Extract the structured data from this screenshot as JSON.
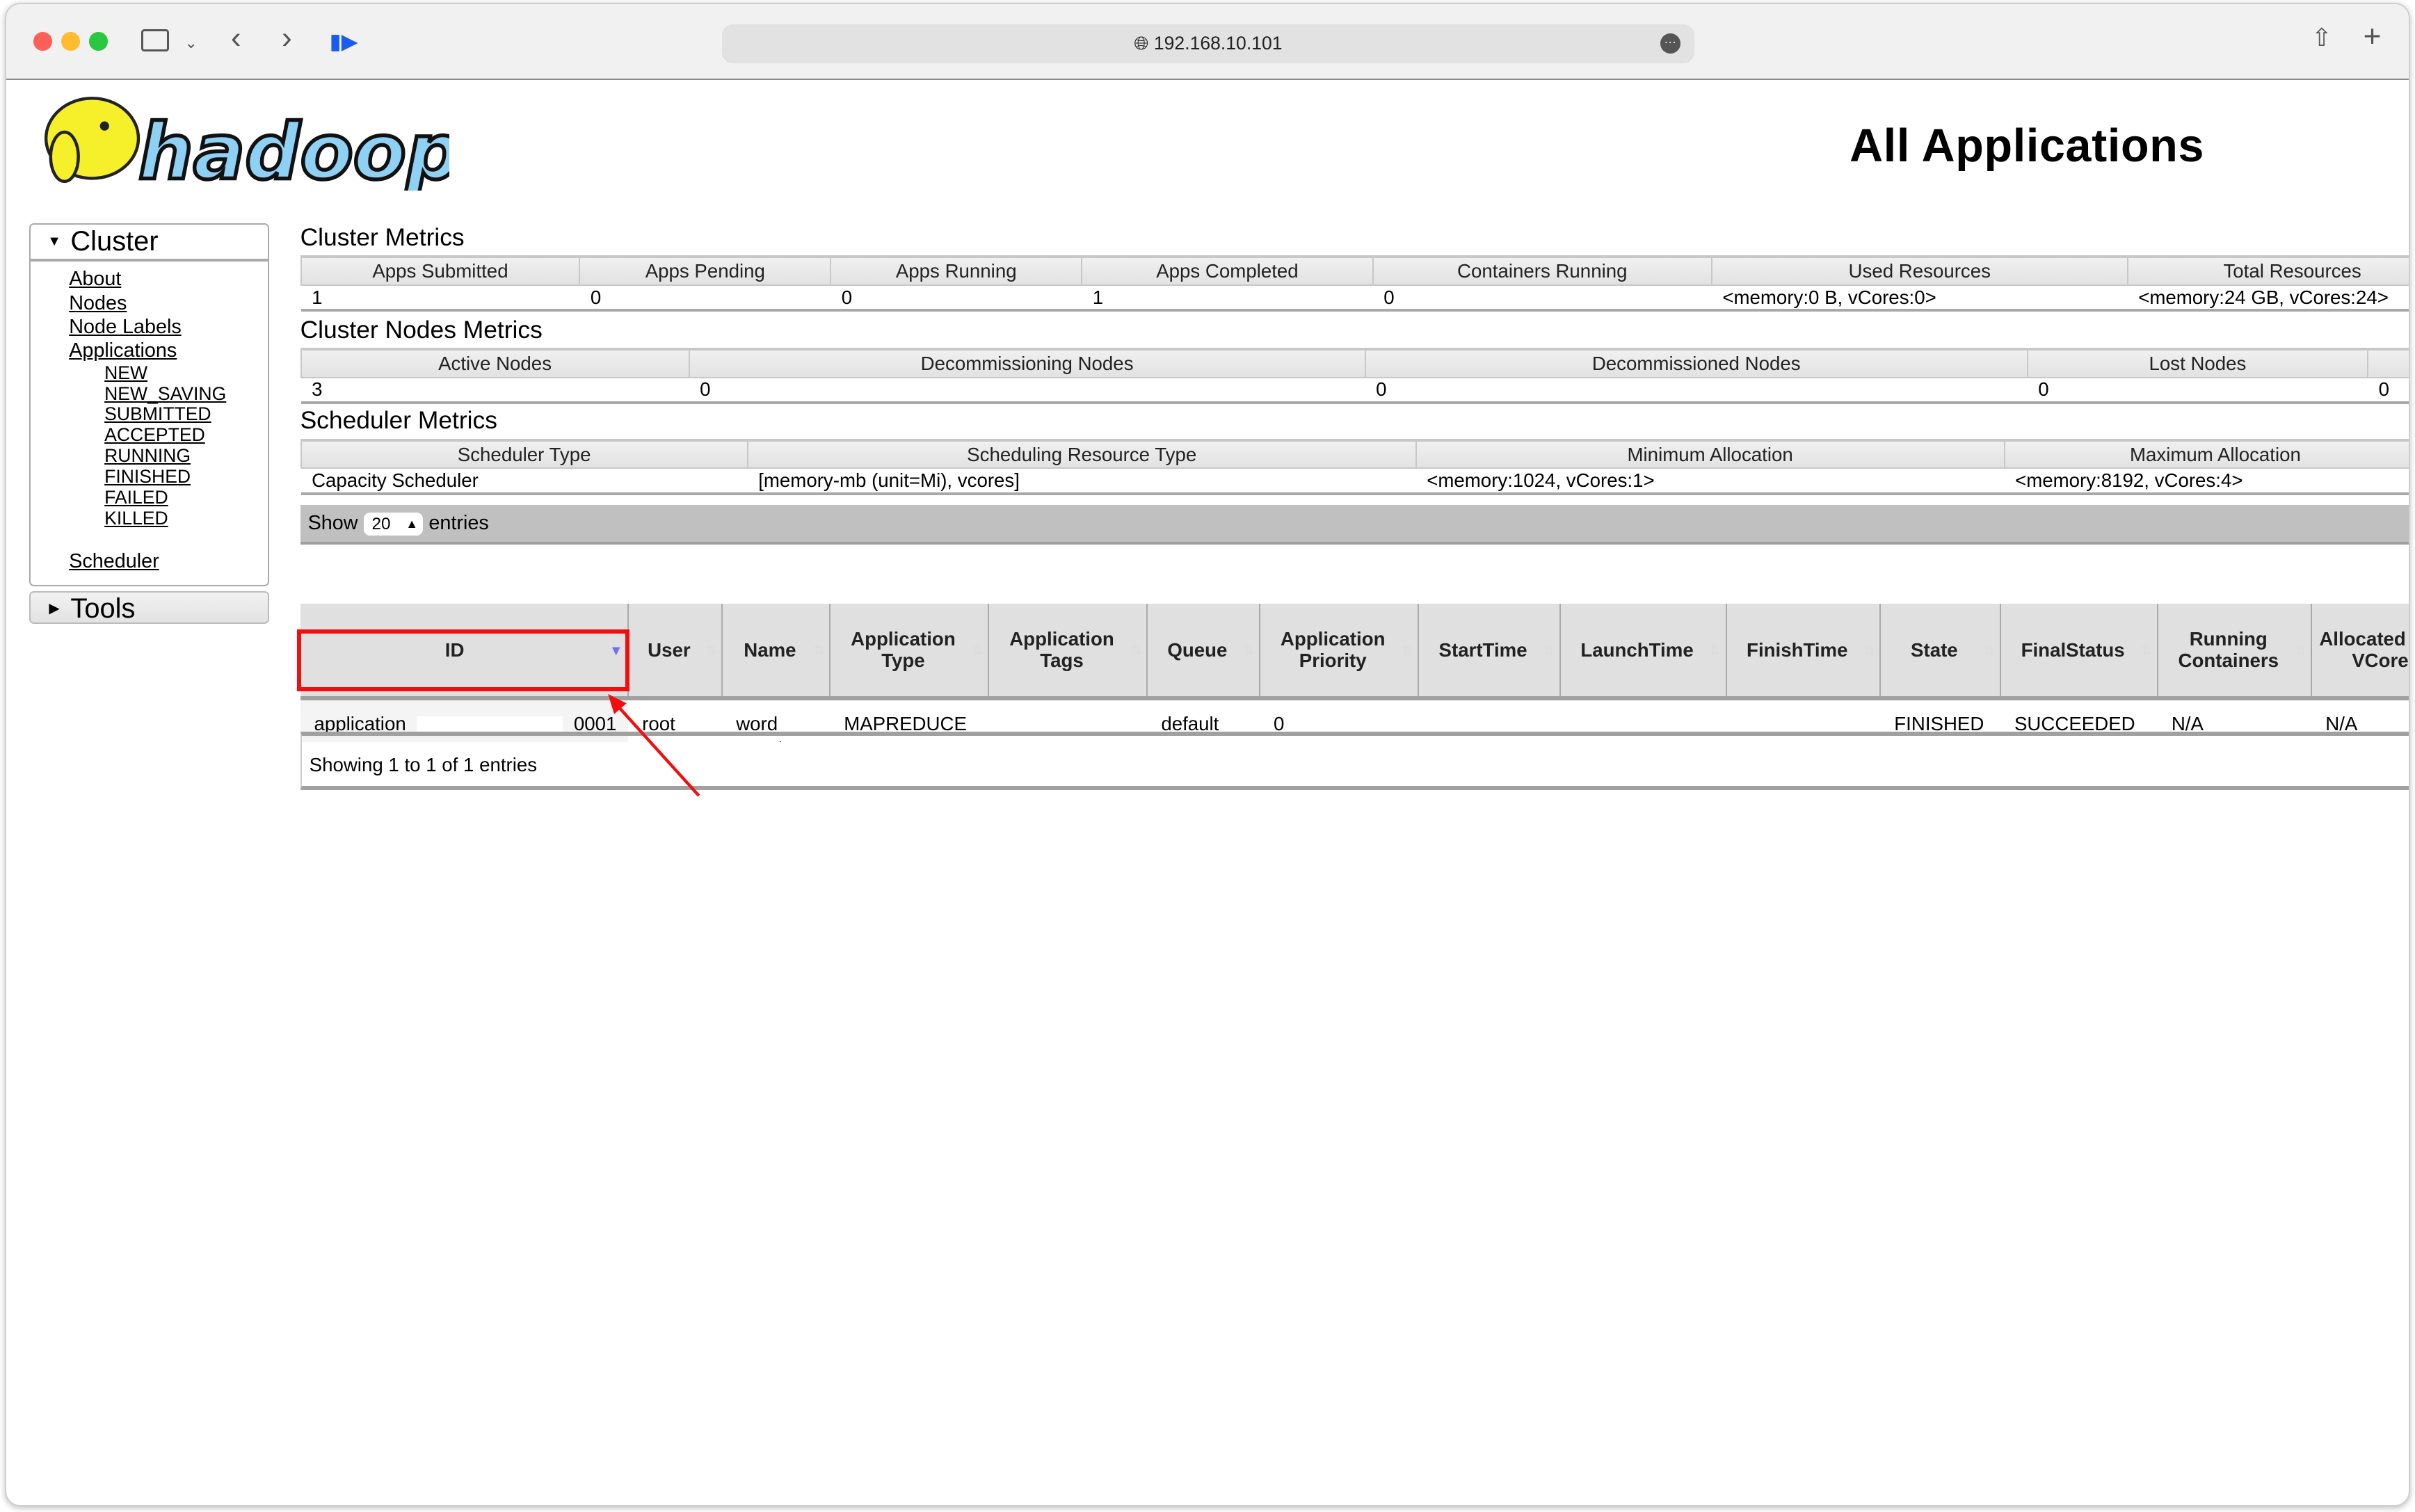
{
  "browser": {
    "url": "192.168.10.101"
  },
  "header": {
    "title": "All Applications",
    "logo_text": "hadoop"
  },
  "sidebar": {
    "cluster_label": "Cluster",
    "items": [
      {
        "label": "About",
        "level": 1
      },
      {
        "label": "Nodes",
        "level": 1
      },
      {
        "label": "Node Labels",
        "level": 1
      },
      {
        "label": "Applications",
        "level": 1
      },
      {
        "label": "NEW",
        "level": 2
      },
      {
        "label": "NEW_SAVING",
        "level": 2
      },
      {
        "label": "SUBMITTED",
        "level": 2
      },
      {
        "label": "ACCEPTED",
        "level": 2
      },
      {
        "label": "RUNNING",
        "level": 2
      },
      {
        "label": "FINISHED",
        "level": 2
      },
      {
        "label": "FAILED",
        "level": 2
      },
      {
        "label": "KILLED",
        "level": 2
      }
    ],
    "scheduler_label": "Scheduler",
    "tools_label": "Tools"
  },
  "cluster_metrics": {
    "title": "Cluster Metrics",
    "headers": [
      "Apps Submitted",
      "Apps Pending",
      "Apps Running",
      "Apps Completed",
      "Containers Running",
      "Used Resources",
      "Total Resources"
    ],
    "values": [
      "1",
      "0",
      "0",
      "1",
      "0",
      "<memory:0 B, vCores:0>",
      "<memory:24 GB, vCores:24>"
    ]
  },
  "nodes_metrics": {
    "title": "Cluster Nodes Metrics",
    "headers": [
      "Active Nodes",
      "Decommissioning Nodes",
      "Decommissioned Nodes",
      "Lost Nodes",
      ""
    ],
    "values": [
      "3",
      "0",
      "0",
      "0",
      "0"
    ]
  },
  "scheduler_metrics": {
    "title": "Scheduler Metrics",
    "headers": [
      "Scheduler Type",
      "Scheduling Resource Type",
      "Minimum Allocation",
      "Maximum Allocation"
    ],
    "values": [
      "Capacity Scheduler",
      "[memory-mb (unit=Mi), vcores]",
      "<memory:1024, vCores:1>",
      "<memory:8192, vCores:4>"
    ]
  },
  "apps_table": {
    "show_label": "Show",
    "page_size": "20",
    "entries_label": "entries",
    "headers": [
      "ID",
      "User",
      "Name",
      "Application Type",
      "Application Tags",
      "Queue",
      "Application Priority",
      "StartTime",
      "LaunchTime",
      "FinishTime",
      "State",
      "FinalStatus",
      "Running Containers",
      "Allocated CPU VCores"
    ],
    "sorted_column": "ID",
    "rows": [
      {
        "id_prefix": "application_",
        "id_suffix": "_0001",
        "cells": [
          "root",
          "word count",
          "MAPREDUCE",
          "",
          "default",
          "0",
          "",
          "",
          "",
          "FINISHED",
          "SUCCEEDED",
          "N/A",
          "N/A"
        ]
      }
    ],
    "footer": "Showing 1 to 1 of 1 entries"
  },
  "annotation_color": "#f00e0e"
}
